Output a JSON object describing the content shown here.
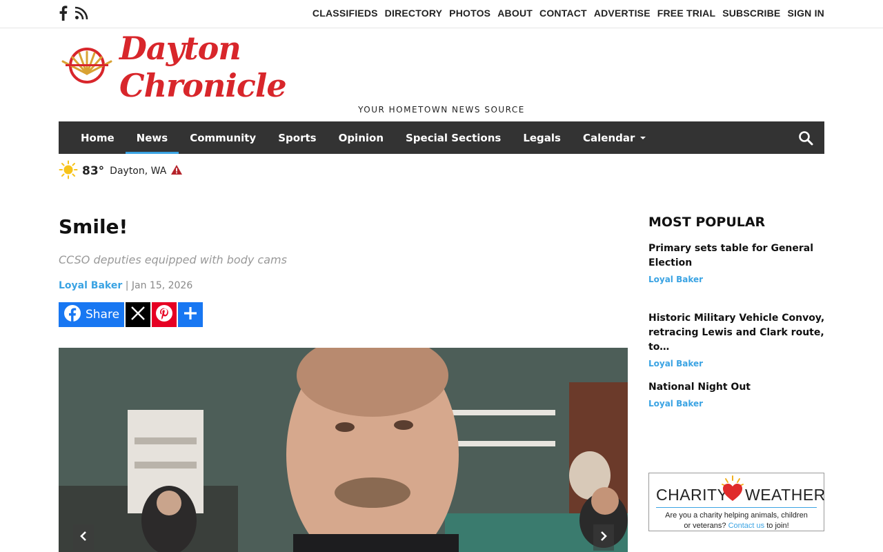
{
  "topbar": {
    "social": [
      {
        "icon": "facebook-icon"
      },
      {
        "icon": "rss-icon"
      }
    ],
    "links": [
      "CLASSIFIEDS",
      "DIRECTORY",
      "PHOTOS",
      "ABOUT",
      "CONTACT",
      "ADVERTISE",
      "FREE TRIAL",
      "SUBSCRIBE",
      "SIGN IN"
    ]
  },
  "masthead": {
    "name": "Dayton Chronicle",
    "tagline": "YOUR HOMETOWN NEWS SOURCE",
    "brand_color": "#d8262b"
  },
  "nav": {
    "items": [
      "Home",
      "News",
      "Community",
      "Sports",
      "Opinion",
      "Special Sections",
      "Legals",
      "Calendar"
    ],
    "active": "News",
    "accent": "#3aa3e3"
  },
  "weather": {
    "temp": "83°",
    "location": "Dayton, WA"
  },
  "article": {
    "headline": "Smile!",
    "subhead": "CCSO deputies equipped with body cams",
    "author": "Loyal Baker",
    "separator": "|",
    "date": "Jan 15, 2026",
    "share_label": "Share"
  },
  "sidebar": {
    "title": "MOST POPULAR",
    "items": [
      {
        "title": "Primary sets table for General Election",
        "author": "Loyal Baker"
      },
      {
        "title": "Historic Military Vehicle Convoy, retracing Lewis and Clark route, to…",
        "author": "Loyal Baker"
      },
      {
        "title": "National Night Out",
        "author": "Loyal Baker"
      }
    ],
    "ad": {
      "word1": "CHARITY",
      "word2": "WEATHER",
      "line1": "Are you a charity helping animals, children",
      "line2a": "or veterans?",
      "link": "Contact us",
      "line2b": "to join!"
    }
  }
}
